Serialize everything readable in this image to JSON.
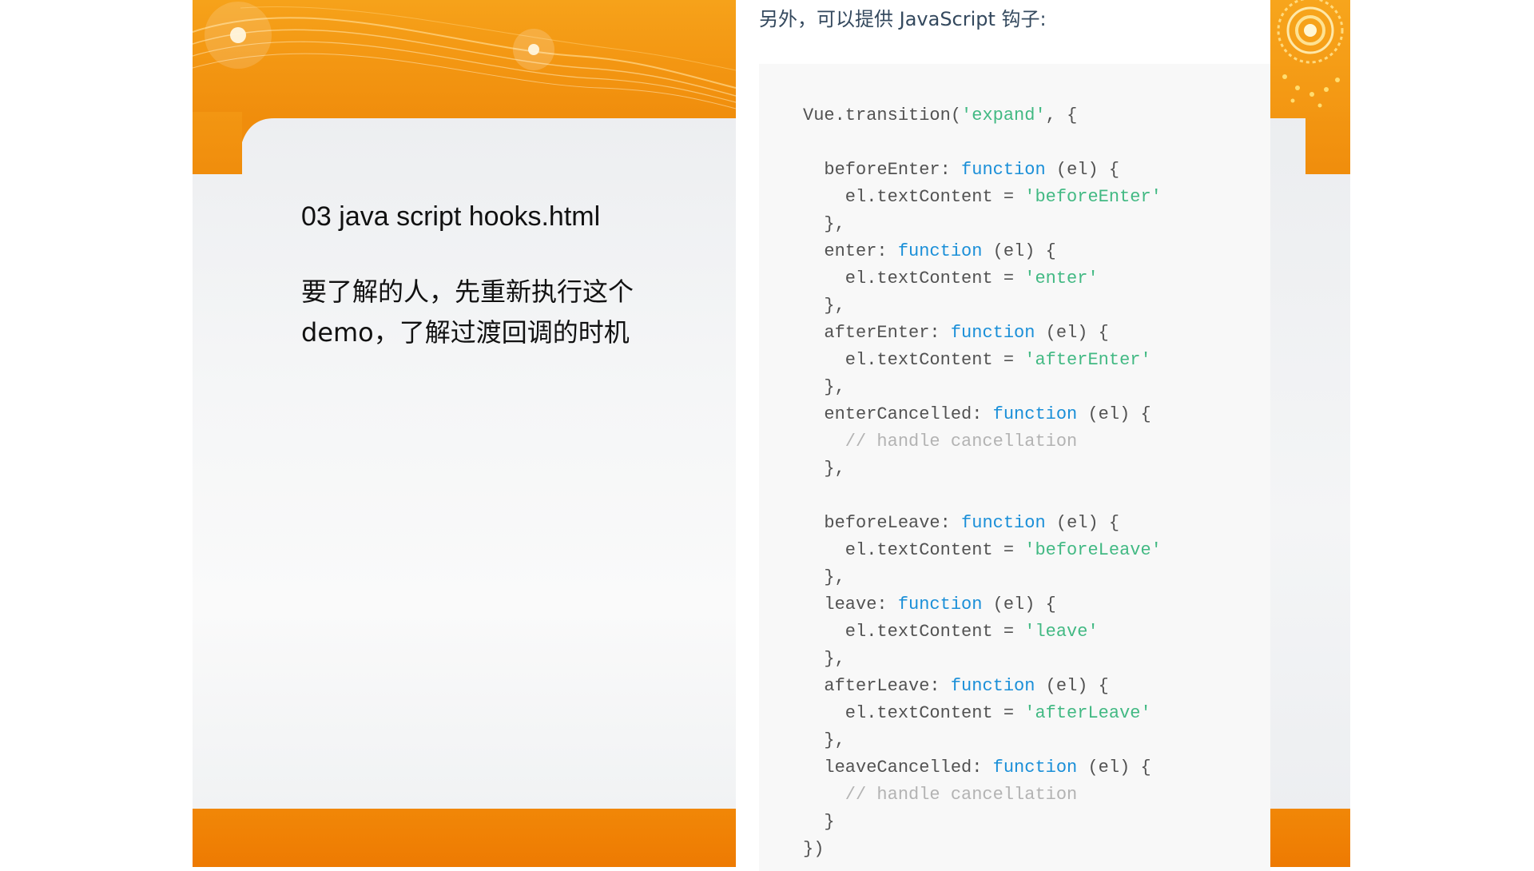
{
  "slide": {
    "title": "03 java script hooks.html",
    "body_line1": "要了解的人，先重新执行这个",
    "body_line2": "demo，了解过渡回调的时机"
  },
  "doc": {
    "heading": "另外，可以提供 JavaScript 钩子:"
  },
  "code": {
    "lines": [
      [
        {
          "t": "Vue.transition(",
          "k": "plain"
        },
        {
          "t": "'expand'",
          "k": "string"
        },
        {
          "t": ", {",
          "k": "plain"
        }
      ],
      [],
      [
        {
          "t": "  beforeEnter: ",
          "k": "plain"
        },
        {
          "t": "function",
          "k": "keyword"
        },
        {
          "t": " (el) {",
          "k": "plain"
        }
      ],
      [
        {
          "t": "    el.textContent = ",
          "k": "plain"
        },
        {
          "t": "'beforeEnter'",
          "k": "string"
        }
      ],
      [
        {
          "t": "  },",
          "k": "plain"
        }
      ],
      [
        {
          "t": "  enter: ",
          "k": "plain"
        },
        {
          "t": "function",
          "k": "keyword"
        },
        {
          "t": " (el) {",
          "k": "plain"
        }
      ],
      [
        {
          "t": "    el.textContent = ",
          "k": "plain"
        },
        {
          "t": "'enter'",
          "k": "string"
        }
      ],
      [
        {
          "t": "  },",
          "k": "plain"
        }
      ],
      [
        {
          "t": "  afterEnter: ",
          "k": "plain"
        },
        {
          "t": "function",
          "k": "keyword"
        },
        {
          "t": " (el) {",
          "k": "plain"
        }
      ],
      [
        {
          "t": "    el.textContent = ",
          "k": "plain"
        },
        {
          "t": "'afterEnter'",
          "k": "string"
        }
      ],
      [
        {
          "t": "  },",
          "k": "plain"
        }
      ],
      [
        {
          "t": "  enterCancelled: ",
          "k": "plain"
        },
        {
          "t": "function",
          "k": "keyword"
        },
        {
          "t": " (el) {",
          "k": "plain"
        }
      ],
      [
        {
          "t": "    // handle cancellation",
          "k": "comment"
        }
      ],
      [
        {
          "t": "  },",
          "k": "plain"
        }
      ],
      [],
      [
        {
          "t": "  beforeLeave: ",
          "k": "plain"
        },
        {
          "t": "function",
          "k": "keyword"
        },
        {
          "t": " (el) {",
          "k": "plain"
        }
      ],
      [
        {
          "t": "    el.textContent = ",
          "k": "plain"
        },
        {
          "t": "'beforeLeave'",
          "k": "string"
        }
      ],
      [
        {
          "t": "  },",
          "k": "plain"
        }
      ],
      [
        {
          "t": "  leave: ",
          "k": "plain"
        },
        {
          "t": "function",
          "k": "keyword"
        },
        {
          "t": " (el) {",
          "k": "plain"
        }
      ],
      [
        {
          "t": "    el.textContent = ",
          "k": "plain"
        },
        {
          "t": "'leave'",
          "k": "string"
        }
      ],
      [
        {
          "t": "  },",
          "k": "plain"
        }
      ],
      [
        {
          "t": "  afterLeave: ",
          "k": "plain"
        },
        {
          "t": "function",
          "k": "keyword"
        },
        {
          "t": " (el) {",
          "k": "plain"
        }
      ],
      [
        {
          "t": "    el.textContent = ",
          "k": "plain"
        },
        {
          "t": "'afterLeave'",
          "k": "string"
        }
      ],
      [
        {
          "t": "  },",
          "k": "plain"
        }
      ],
      [
        {
          "t": "  leaveCancelled: ",
          "k": "plain"
        },
        {
          "t": "function",
          "k": "keyword"
        },
        {
          "t": " (el) {",
          "k": "plain"
        }
      ],
      [
        {
          "t": "    // handle cancellation",
          "k": "comment"
        }
      ],
      [
        {
          "t": "  }",
          "k": "plain"
        }
      ],
      [
        {
          "t": "})",
          "k": "plain"
        }
      ]
    ]
  },
  "colors": {
    "slide_orange": "#f39612",
    "slide_orange_dark": "#ee7a02",
    "code_background": "#f8f8f8",
    "code_text": "#525252",
    "code_keyword": "#1a8fd8",
    "code_string": "#42b983",
    "code_comment": "#b3b3b3",
    "heading_text": "#34495e"
  }
}
